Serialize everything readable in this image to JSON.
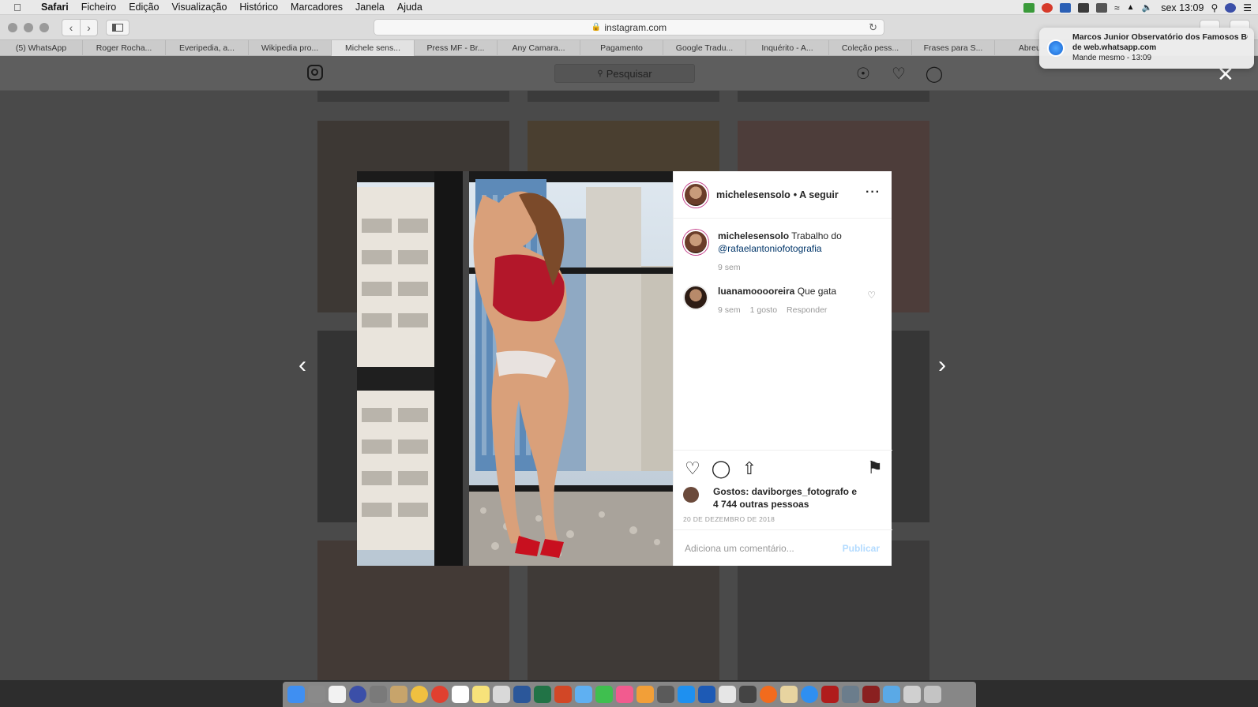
{
  "menubar": {
    "app": "Safari",
    "items": [
      "Ficheiro",
      "Edição",
      "Visualização",
      "Histórico",
      "Marcadores",
      "Janela",
      "Ajuda"
    ],
    "clock": "sex 13:09"
  },
  "browser": {
    "url": "instagram.com",
    "tabs": [
      "(5) WhatsApp",
      "Roger Rocha...",
      "Everipedia, a...",
      "Wikipedia pro...",
      "Michele sens...",
      "Press MF - Br...",
      "Any Camara...",
      "Pagamento",
      "Google Tradu...",
      "Inquérito - A...",
      "Coleção pess...",
      "Frases para S...",
      "Abreu - V"
    ],
    "active_tab_index": 4
  },
  "instagram": {
    "search_placeholder": "Pesquisar"
  },
  "post": {
    "username": "michelesensolo",
    "follow_text": "• A seguir",
    "caption_user": "michelesensolo",
    "caption_text": "Trabalho do",
    "caption_mention": "@rafaelantoniofotografia",
    "caption_time": "9 sem",
    "comment": {
      "user": "luanamooooreira",
      "text": "Que gata",
      "time": "9 sem",
      "likes": "1 gosto",
      "reply": "Responder"
    },
    "likes_line1": "Gostos: daviborges_fotografo e",
    "likes_line2": "4 744 outras pessoas",
    "date": "20 DE DEZEMBRO DE 2018",
    "comment_placeholder": "Adiciona um comentário...",
    "publish_label": "Publicar"
  },
  "notification": {
    "title": "Marcos Junior Observatório dos Famosos BOL",
    "source": "de web.whatsapp.com",
    "message": "Mande mesmo - 13:09"
  },
  "icons": {
    "apple": "apple-logo-icon",
    "close": "close-icon",
    "prev": "chevron-left-icon",
    "next": "chevron-right-icon"
  },
  "colors": {
    "instagram_link": "#003569",
    "publish_disabled": "#b3dbff",
    "story_ring": "#c13584"
  }
}
